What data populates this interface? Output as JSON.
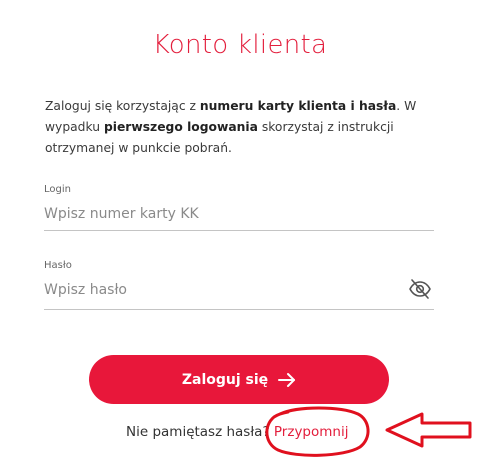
{
  "header": {
    "title": "Konto klienta"
  },
  "intro": {
    "part1": "Zaloguj się korzystając z ",
    "bold1": "numeru karty klienta i hasła",
    "part2": ". W wypadku ",
    "bold2": "pierwszego logowania",
    "part3": " skorzystaj z instrukcji otrzymanej w punkcie pobrań."
  },
  "login_field": {
    "label": "Login",
    "placeholder": "Wpisz numer karty KK",
    "value": ""
  },
  "password_field": {
    "label": "Hasło",
    "placeholder": "Wpisz hasło",
    "value": "",
    "toggle_icon": "eye-off-icon"
  },
  "login_button": {
    "label": "Zaloguj się",
    "icon": "arrow-right-icon"
  },
  "remind": {
    "question": "Nie pamiętasz hasła?",
    "link": "Przypomnij"
  },
  "colors": {
    "accent": "#e31e3c",
    "button": "#e8173a",
    "annotation": "#e0101e"
  }
}
